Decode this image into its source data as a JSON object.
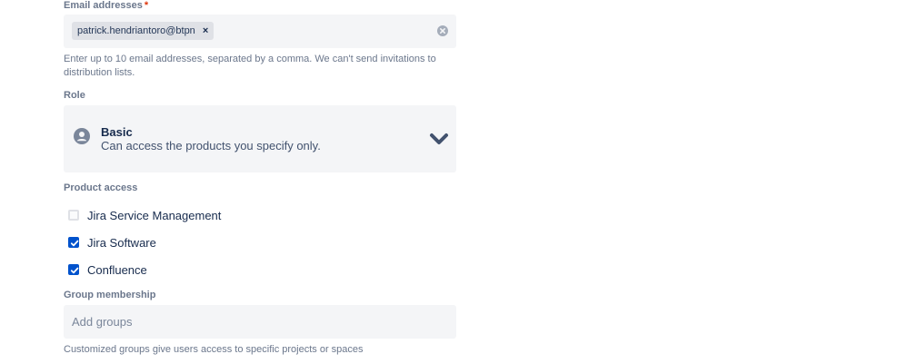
{
  "email": {
    "label": "Email addresses",
    "required_mark": "*",
    "chip_text": "patrick.hendriantoro@btpn",
    "chip_remove": "×",
    "help": "Enter up to 10 email addresses, separated by a comma. We can't send invitations to distribution lists."
  },
  "role": {
    "label": "Role",
    "selected_title": "Basic",
    "selected_description": "Can access the products you specify only.",
    "icon": "user-avatar-icon"
  },
  "product_access": {
    "label": "Product access",
    "items": [
      {
        "label": "Jira Service Management",
        "checked": false
      },
      {
        "label": "Jira Software",
        "checked": true
      },
      {
        "label": "Confluence",
        "checked": true
      }
    ]
  },
  "groups": {
    "label": "Group membership",
    "placeholder": "Add groups",
    "value": "",
    "help": "Customized groups give users access to specific projects or spaces"
  },
  "colors": {
    "field_bg": "#f4f5f7",
    "checkbox_checked": "#0052cc",
    "label_text": "#6b778c",
    "required": "#de350b"
  }
}
